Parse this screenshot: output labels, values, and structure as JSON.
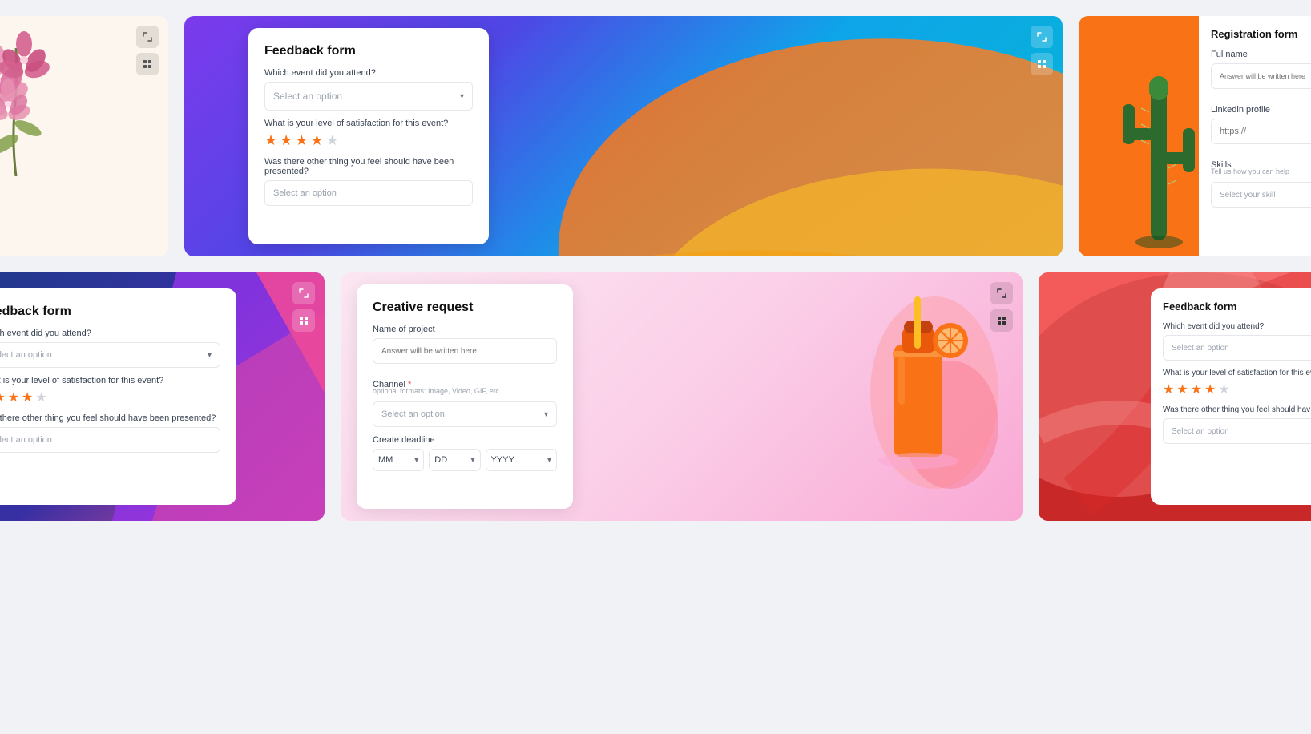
{
  "page": {
    "bg": "#f0f2f5"
  },
  "card1": {
    "type": "orchid",
    "bg": "#fdf6ee"
  },
  "card2": {
    "type": "feedback-main",
    "title": "Feedback form",
    "q1_label": "Which event did you attend?",
    "q1_placeholder": "Select an option",
    "q2_label": "What is your level of satisfaction for this event?",
    "stars_filled": 4,
    "stars_total": 5,
    "q3_label": "Was there other thing you feel should have been presented?",
    "q3_placeholder": "Select an option"
  },
  "card3": {
    "type": "registration",
    "title": "Registration form",
    "name_label": "Ful name",
    "name_placeholder": "Answer will be written here",
    "linkedin_label": "Linkedin profile",
    "linkedin_placeholder": "https://",
    "skills_label": "Skills",
    "skills_hint": "Tell us how you can help",
    "skills_placeholder": "Select your skill"
  },
  "card4": {
    "type": "feedback-bottom-left",
    "title": "Feedback form",
    "q1_label": "Which event did you attend?",
    "q1_placeholder": "Select an option",
    "q2_label": "What is your level of satisfaction for this event?",
    "stars_filled": 4,
    "stars_total": 5,
    "q3_label": "Was there other thing you feel should have been presented?",
    "q3_placeholder": "Select an option"
  },
  "card5": {
    "type": "creative-request",
    "title": "Creative request",
    "name_label": "Name of project",
    "name_placeholder": "Answer will be written here",
    "channel_label": "Channel",
    "channel_required": true,
    "channel_hint": "optional formats: Image, Video, GIF, etc.",
    "channel_placeholder": "Select an option",
    "deadline_label": "Create deadline",
    "month_placeholder": "MM",
    "day_placeholder": "DD",
    "year_placeholder": "YYYY"
  },
  "card6": {
    "type": "feedback-bottom-right",
    "title": "Feedback form",
    "q1_label": "Which event did you attend?",
    "q1_placeholder": "Select an option",
    "q2_label": "What is your level of satisfaction for this eve",
    "stars_filled": 4,
    "stars_total": 5,
    "q3_label": "Was there other thing you feel should hav b",
    "q3_placeholder": "Select an option"
  },
  "icons": {
    "expand": "⤢",
    "grid": "⊞",
    "chevron_down": "▾"
  }
}
